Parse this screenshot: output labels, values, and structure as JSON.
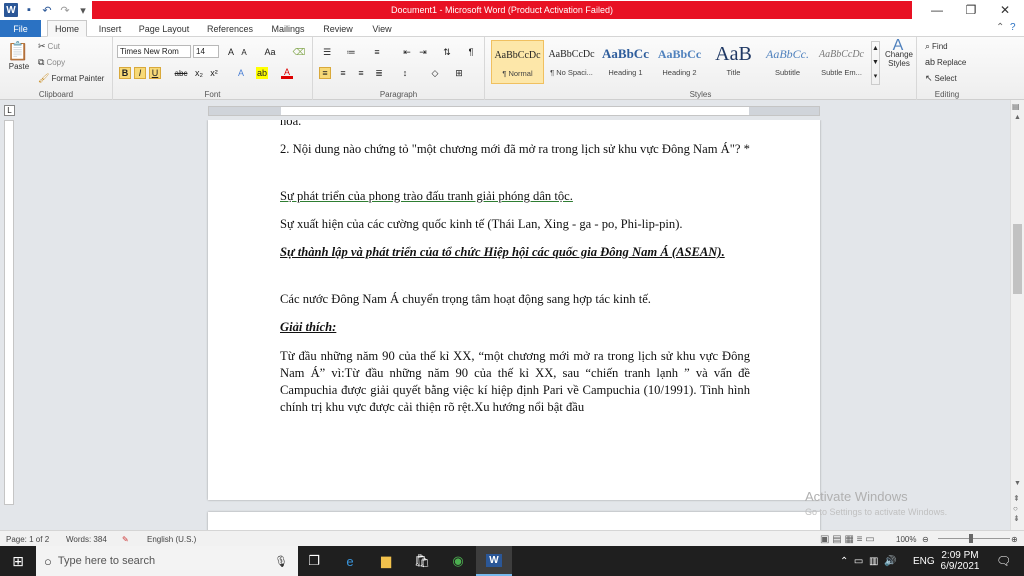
{
  "window": {
    "title": "Document1 - Microsoft Word (Product Activation Failed)",
    "qat": [
      "word-icon",
      "save-icon",
      "undo-icon",
      "redo-icon",
      "customize-icon"
    ]
  },
  "tabs": [
    "File",
    "Home",
    "Insert",
    "Page Layout",
    "References",
    "Mailings",
    "Review",
    "View"
  ],
  "ribbon": {
    "clipboard": {
      "label": "Clipboard",
      "paste": "Paste",
      "cut": "Cut",
      "copy": "Copy",
      "format_painter": "Format Painter"
    },
    "font": {
      "label": "Font",
      "name": "Times New Rom",
      "size": "14",
      "bold": "B",
      "italic": "I",
      "underline": "U"
    },
    "paragraph": {
      "label": "Paragraph"
    },
    "styles": {
      "label": "Styles",
      "items": [
        {
          "preview": "AaBbCcDc",
          "name": "¶ Normal"
        },
        {
          "preview": "AaBbCcDc",
          "name": "¶ No Spaci..."
        },
        {
          "preview": "AaBbCc",
          "name": "Heading 1"
        },
        {
          "preview": "AaBbCc",
          "name": "Heading 2"
        },
        {
          "preview": "AaB",
          "name": "Title"
        },
        {
          "preview": "AaBbCc.",
          "name": "Subtitle"
        },
        {
          "preview": "AaBbCcDc",
          "name": "Subtle Em..."
        }
      ],
      "change_styles": "Change Styles"
    },
    "editing": {
      "label": "Editing",
      "find": "Find",
      "replace": "Replace",
      "select": "Select"
    }
  },
  "document": {
    "partial_top": "hóa.",
    "question": "2. Nội dung nào chứng tỏ \"một chương mới đã mở ra trong lịch sử khu vực Đông Nam Á\"? *",
    "option1": "Sự phát triển của phong trào đấu tranh giải phóng dân tộc.",
    "option2": "Sự xuất hiện của các cường quốc kinh tế (Thái Lan, Xing - ga - po, Phi-lip-pin).",
    "option3": "Sự thành lập và phát triển của tổ chức Hiệp hội các quốc gia Đông Nam Á (ASEAN).",
    "option4": " Các nước Đông Nam Á chuyển trọng tâm hoạt động sang hợp tác kinh tế.",
    "explain_heading": "Giải thích:",
    "explanation": "Từ đầu những năm 90 của thế kỉ XX, “một chương mới mở ra trong lịch sử khu vực Đông Nam Á” vì:Từ đầu những năm 90 của thế kỉ XX, sau “chiến tranh lạnh ” và vấn đề Campuchia được giải quyết bằng việc kí hiệp định Pari về Campuchia (10/1991). Tình hình chính trị khu vực được cải thiện rõ rệt.Xu hướng nổi bật đầu"
  },
  "watermark": {
    "line1": "Activate Windows",
    "line2": "Go to Settings to activate Windows."
  },
  "statusbar": {
    "page": "Page: 1 of 2",
    "words": "Words: 384",
    "language": "English (U.S.)",
    "zoom": "100%"
  },
  "taskbar": {
    "search_placeholder": "Type here to search",
    "time": "2:09 PM",
    "date": "6/9/2021",
    "lang": "ENG"
  }
}
